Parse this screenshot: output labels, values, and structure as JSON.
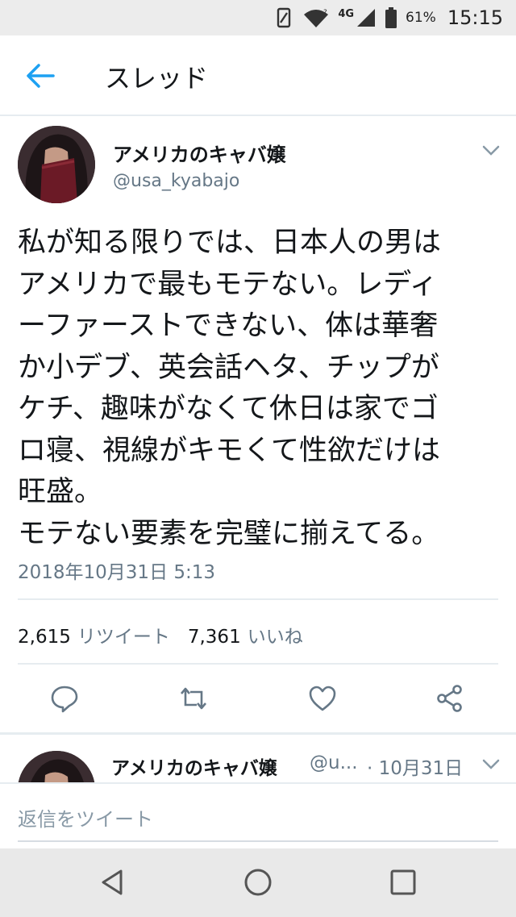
{
  "status_bar": {
    "network": "4G",
    "battery_percent": "61%",
    "time": "15:15"
  },
  "header": {
    "title": "スレッド",
    "back_icon": "back-arrow-icon"
  },
  "tweet": {
    "user_name": "アメリカのキャバ嬢",
    "handle": "@usa_kyabajo",
    "text": "私が知る限りでは、日本人の男は\nアメリカで最もモテない。レディ\nーファーストできない、体は華奢\nか小デブ、英会話ヘタ、チップが\nケチ、趣味がなくて休日は家でゴ\nロ寝、視線がキモくて性欲だけは\n旺盛。\nモテない要素を完璧に揃えてる。",
    "timestamp": "2018年10月31日 5:13",
    "retweets_count": "2,615",
    "retweets_label": "リツイート",
    "likes_count": "7,361",
    "likes_label": "いいね",
    "actions": [
      "reply-icon",
      "retweet-icon",
      "like-icon",
      "share-icon"
    ]
  },
  "reply_preview": {
    "user_name": "アメリカのキャバ嬢",
    "handle": "@u...",
    "date": "· 10月31日"
  },
  "compose": {
    "placeholder": "返信をツイート"
  },
  "colors": {
    "accent": "#1da1f2",
    "secondary_text": "#657786",
    "divider": "#e6ecf0"
  }
}
